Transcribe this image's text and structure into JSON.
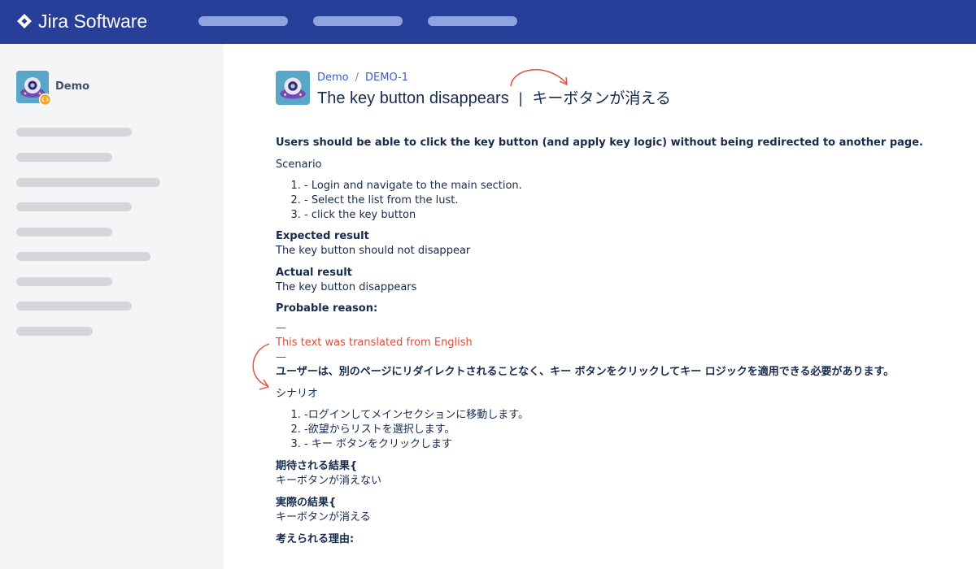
{
  "app": {
    "name": "Jira Software",
    "brand_color": "#283f9a",
    "logo_icon": "jira-diamond-icon"
  },
  "sidebar": {
    "project_name": "Demo",
    "project_icon": "ufo-project-icon"
  },
  "issue": {
    "breadcrumb": [
      "Demo",
      "DEMO-1"
    ],
    "breadcrumb_sep": "/",
    "title": "The key button disappears",
    "title_divider": "|",
    "title_translated": "キーボタンが消える",
    "english": {
      "summary": "Users should be able to click the key button (and apply key logic) without being redirected to another page.",
      "scenario_label": "Scenario",
      "steps": [
        "- Login and navigate to the main section.",
        "- Select the list from the lust.",
        "- click the key button"
      ],
      "expected_label": "Expected result",
      "expected_text": "The key button should not disappear",
      "actual_label": "Actual result",
      "actual_text": "The key button disappears",
      "reason_label": "Probable reason:"
    },
    "separator": "—",
    "translation_note": "This text was translated from English",
    "japanese": {
      "summary": "ユーザーは、別のページにリダイレクトされることなく、キー ボタンをクリックしてキー ロジックを適用できる必要があります。",
      "scenario_label": "シナリオ",
      "steps": [
        "-ログインしてメインセクションに移動します。",
        "-欲望からリストを選択します。",
        "- キー ボタンをクリックします"
      ],
      "expected_label": "期待される結果{",
      "expected_text": "キーボタンが消えない",
      "actual_label": "実際の結果{",
      "actual_text": "キーボタンが消える",
      "reason_label": "考えられる理由:"
    },
    "accent_color": "#de4d3a"
  }
}
